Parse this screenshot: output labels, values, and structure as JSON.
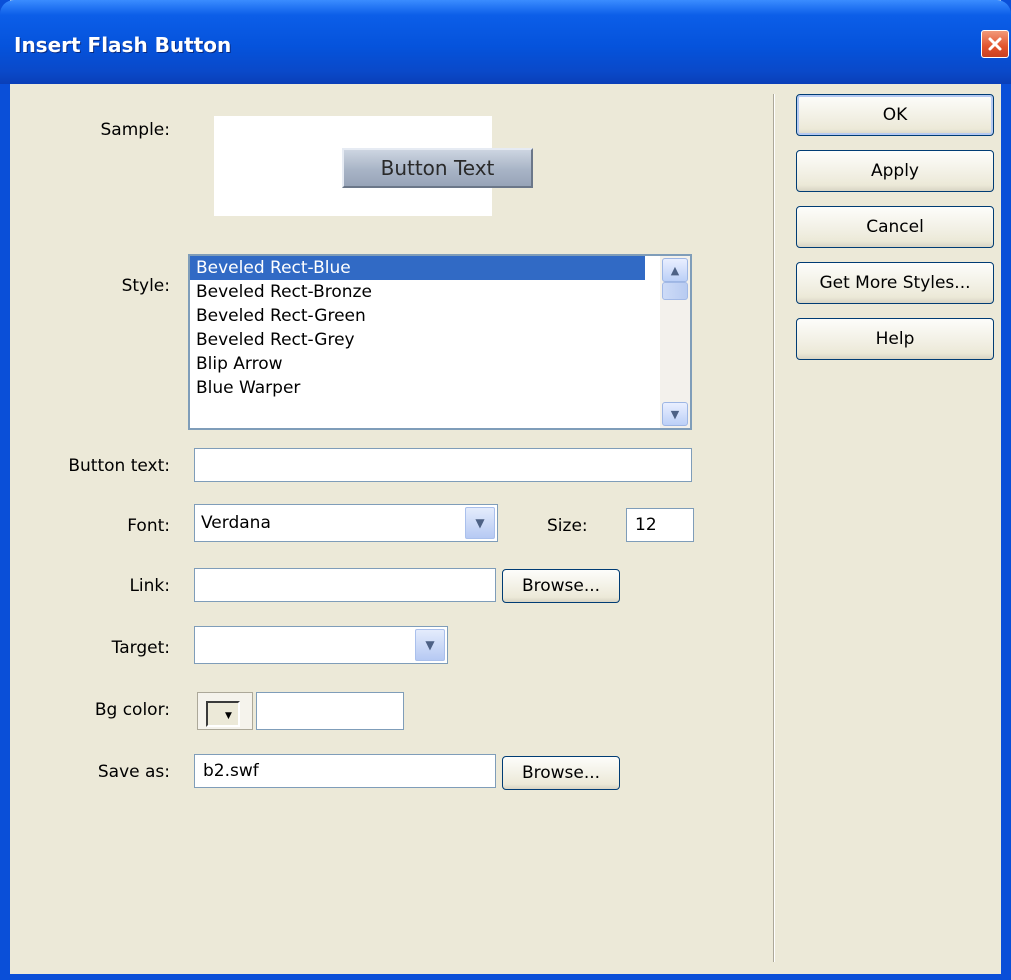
{
  "window": {
    "title": "Insert Flash Button"
  },
  "labels": {
    "sample": "Sample:",
    "style": "Style:",
    "button_text": "Button text:",
    "font": "Font:",
    "size": "Size:",
    "link": "Link:",
    "target": "Target:",
    "bg_color": "Bg color:",
    "save_as": "Save as:"
  },
  "sample": {
    "button_label": "Button Text"
  },
  "style_list": {
    "items": [
      "Beveled Rect-Blue",
      "Beveled Rect-Bronze",
      "Beveled Rect-Green",
      "Beveled Rect-Grey",
      "Blip Arrow",
      "Blue Warper"
    ],
    "selected": "Beveled Rect-Blue"
  },
  "fields": {
    "button_text": "",
    "font": "Verdana",
    "size": "12",
    "link": "",
    "target": "",
    "bg_color": "",
    "save_as": "b2.swf"
  },
  "buttons": {
    "ok": "OK",
    "apply": "Apply",
    "cancel": "Cancel",
    "get_more_styles": "Get More Styles...",
    "help": "Help",
    "browse_link": "Browse...",
    "browse_save": "Browse..."
  },
  "colors": {
    "title_bar": "#0553dc",
    "selection": "#316ac5",
    "dialog_bg": "#ece9d8"
  }
}
